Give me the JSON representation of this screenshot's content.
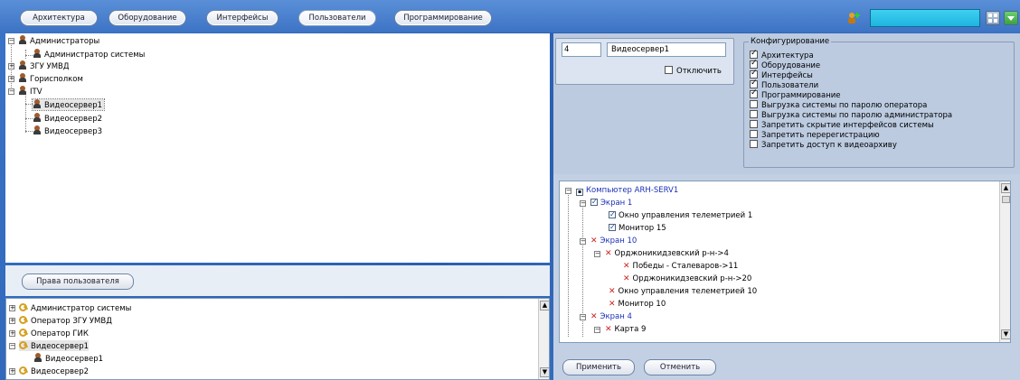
{
  "tabs": [
    {
      "label": "Архитектура"
    },
    {
      "label": "Оборудование"
    },
    {
      "label": "Интерфейсы"
    },
    {
      "label": "Пользователи"
    },
    {
      "label": "Программирование"
    }
  ],
  "user_tree": {
    "items": [
      {
        "label": "Администраторы"
      },
      {
        "label": "Администратор системы"
      },
      {
        "label": "ЗГУ УМВД"
      },
      {
        "label": "Горисполком"
      },
      {
        "label": "ITV"
      },
      {
        "label": "Видеосервер1"
      },
      {
        "label": "Видеосервер2"
      },
      {
        "label": "Видеосервер3"
      }
    ]
  },
  "rights_button": "Права пользователя",
  "rights_tree": {
    "items": [
      {
        "label": "Администратор системы"
      },
      {
        "label": "Оператор ЗГУ УМВД"
      },
      {
        "label": "Оператор ГИК"
      },
      {
        "label": "Видеосервер1"
      },
      {
        "label": "Видеосервер1"
      },
      {
        "label": "Видеосервер2"
      }
    ]
  },
  "props": {
    "id_value": "4",
    "name_value": "Видеосервер1",
    "disable_label": "Отключить"
  },
  "config": {
    "legend": "Конфигурирование",
    "options": [
      {
        "label": "Архитектура",
        "checked": true
      },
      {
        "label": "Оборудование",
        "checked": true
      },
      {
        "label": "Интерфейсы",
        "checked": true
      },
      {
        "label": "Пользователи",
        "checked": true
      },
      {
        "label": "Программирование",
        "checked": true
      },
      {
        "label": "Выгрузка системы по паролю оператора",
        "checked": false
      },
      {
        "label": "Выгрузка системы по паролю администратора",
        "checked": false
      },
      {
        "label": "Запретить скрытие интерфейсов системы",
        "checked": false
      },
      {
        "label": "Запретить перерегистрацию",
        "checked": false
      },
      {
        "label": "Запретить доступ к видеоархиву",
        "checked": false
      }
    ]
  },
  "object_tree": {
    "items": [
      {
        "label": "Компьютер ARH-SERV1"
      },
      {
        "label": "Экран 1"
      },
      {
        "label": "Окно управления телеметрией 1"
      },
      {
        "label": "Монитор 15"
      },
      {
        "label": "Экран 10"
      },
      {
        "label": "Орджоникидзевский р-н->4"
      },
      {
        "label": "Победы - Сталеваров->11"
      },
      {
        "label": "Орджоникидзевский р-н->20"
      },
      {
        "label": "Окно управления телеметрией 10"
      },
      {
        "label": "Монитор 10"
      },
      {
        "label": "Экран 4"
      },
      {
        "label": "Карта 9"
      }
    ]
  },
  "buttons": {
    "apply": "Применить",
    "cancel": "Отменить"
  }
}
